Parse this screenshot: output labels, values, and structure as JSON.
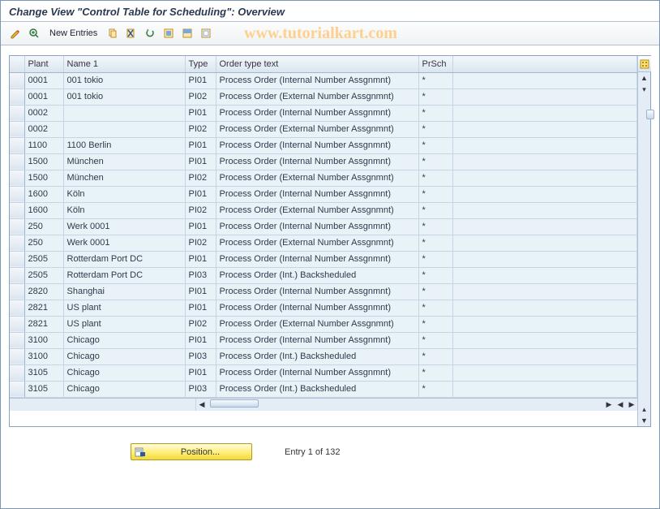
{
  "header": {
    "title": "Change View \"Control Table for Scheduling\": Overview"
  },
  "toolbar": {
    "new_entries": "New Entries"
  },
  "watermark": "www.tutorialkart.com",
  "columns": {
    "plant": "Plant",
    "name": "Name 1",
    "type": "Type",
    "text": "Order type text",
    "prsch": "PrSch"
  },
  "rows": [
    {
      "plant": "0001",
      "name": "001 tokio",
      "type": "PI01",
      "text": "Process Order (Internal Number Assgnmnt)",
      "prsch": "*"
    },
    {
      "plant": "0001",
      "name": "001 tokio",
      "type": "PI02",
      "text": "Process Order (External Number Assgnmnt)",
      "prsch": "*"
    },
    {
      "plant": "0002",
      "name": "",
      "type": "PI01",
      "text": "Process Order (Internal Number Assgnmnt)",
      "prsch": "*"
    },
    {
      "plant": "0002",
      "name": "",
      "type": "PI02",
      "text": "Process Order (External Number Assgnmnt)",
      "prsch": "*"
    },
    {
      "plant": "1100",
      "name": "1100 Berlin",
      "type": "PI01",
      "text": "Process Order (Internal Number Assgnmnt)",
      "prsch": "*"
    },
    {
      "plant": "1500",
      "name": "München",
      "type": "PI01",
      "text": "Process Order (Internal Number Assgnmnt)",
      "prsch": "*"
    },
    {
      "plant": "1500",
      "name": "München",
      "type": "PI02",
      "text": "Process Order (External Number Assgnmnt)",
      "prsch": "*"
    },
    {
      "plant": "1600",
      "name": "Köln",
      "type": "PI01",
      "text": "Process Order (Internal Number Assgnmnt)",
      "prsch": "*"
    },
    {
      "plant": "1600",
      "name": "Köln",
      "type": "PI02",
      "text": "Process Order (External Number Assgnmnt)",
      "prsch": "*"
    },
    {
      "plant": "250",
      "name": "Werk 0001",
      "type": "PI01",
      "text": "Process Order (Internal Number Assgnmnt)",
      "prsch": "*"
    },
    {
      "plant": "250",
      "name": "Werk 0001",
      "type": "PI02",
      "text": "Process Order (External Number Assgnmnt)",
      "prsch": "*"
    },
    {
      "plant": "2505",
      "name": "Rotterdam Port DC",
      "type": "PI01",
      "text": "Process Order (Internal Number Assgnmnt)",
      "prsch": "*"
    },
    {
      "plant": "2505",
      "name": "Rotterdam Port DC",
      "type": "PI03",
      "text": "Process Order (Int.) Backsheduled",
      "prsch": "*"
    },
    {
      "plant": "2820",
      "name": "Shanghai",
      "type": "PI01",
      "text": "Process Order (Internal Number Assgnmnt)",
      "prsch": "*"
    },
    {
      "plant": "2821",
      "name": "US plant",
      "type": "PI01",
      "text": "Process Order (Internal Number Assgnmnt)",
      "prsch": "*"
    },
    {
      "plant": "2821",
      "name": "US plant",
      "type": "PI02",
      "text": "Process Order (External Number Assgnmnt)",
      "prsch": "*"
    },
    {
      "plant": "3100",
      "name": "Chicago",
      "type": "PI01",
      "text": "Process Order (Internal Number Assgnmnt)",
      "prsch": "*"
    },
    {
      "plant": "3100",
      "name": "Chicago",
      "type": "PI03",
      "text": "Process Order (Int.) Backsheduled",
      "prsch": "*"
    },
    {
      "plant": "3105",
      "name": "Chicago",
      "type": "PI01",
      "text": "Process Order (Internal Number Assgnmnt)",
      "prsch": "*"
    },
    {
      "plant": "3105",
      "name": "Chicago",
      "type": "PI03",
      "text": "Process Order (Int.) Backsheduled",
      "prsch": "*"
    }
  ],
  "footer": {
    "position_label": "Position...",
    "entry_text": "Entry 1 of 132"
  }
}
